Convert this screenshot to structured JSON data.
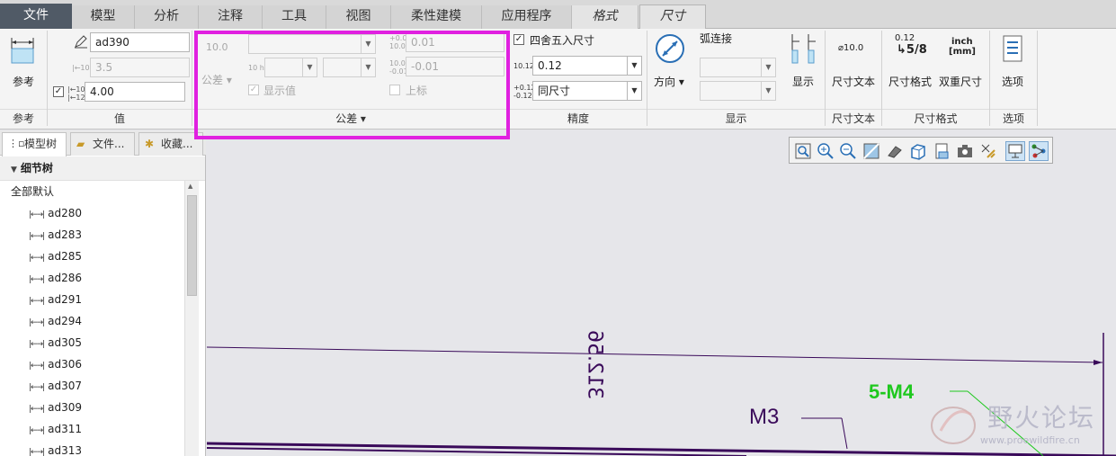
{
  "tabs": [
    "文件",
    "模型",
    "分析",
    "注释",
    "工具",
    "视图",
    "柔性建模",
    "应用程序",
    "格式",
    "尺寸"
  ],
  "ribbon": {
    "reference": {
      "label": "参考",
      "group": "参考"
    },
    "value": {
      "name_field": "ad390",
      "nominal_field": "3.5",
      "override_field": "4.00",
      "override_checked": true,
      "group": "值"
    },
    "tolerance": {
      "value_label": "10.0",
      "button": "公差",
      "upper_value": "0.01",
      "lower_value": "-0.01",
      "show_value": "显示值",
      "upper_label": "上标",
      "group": "公差"
    },
    "precision": {
      "rounding_label": "四舍五入尺寸",
      "rounding_checked": true,
      "decimal_value": "0.12",
      "tolerance_precision": "同尺寸",
      "group": "精度"
    },
    "display": {
      "direction": "方向",
      "arc": "弧连接",
      "show": "显示",
      "group": "显示"
    },
    "dim_text": {
      "label": "尺寸文本",
      "icon_text": "⌀10.0",
      "group": "尺寸文本"
    },
    "dim_format": {
      "format_label": "尺寸格式",
      "dual_label": "双重尺寸",
      "inch": "inch",
      "mm": "[mm]",
      "frac_top": "0.12",
      "frac_bottom": "5/8",
      "group": "尺寸格式"
    },
    "options": {
      "label": "选项",
      "group": "选项"
    }
  },
  "panel": {
    "tabs": [
      "模型树",
      "文件...",
      "收藏..."
    ],
    "header": "细节树",
    "all_default": "全部默认",
    "items": [
      "ad280",
      "ad283",
      "ad285",
      "ad286",
      "ad291",
      "ad294",
      "ad305",
      "ad306",
      "ad307",
      "ad309",
      "ad311",
      "ad313"
    ]
  },
  "drawing": {
    "dim_text": "312.56",
    "label_m3": "M3",
    "label_5m4": "5-M4"
  },
  "watermark": {
    "title": "野火论坛",
    "url": "www.proewildfire.cn"
  },
  "colors": {
    "highlight": "#e020e0",
    "dim_text": "#3a0a5a",
    "green_note": "#1ec81e",
    "file_tab": "#505a66"
  }
}
